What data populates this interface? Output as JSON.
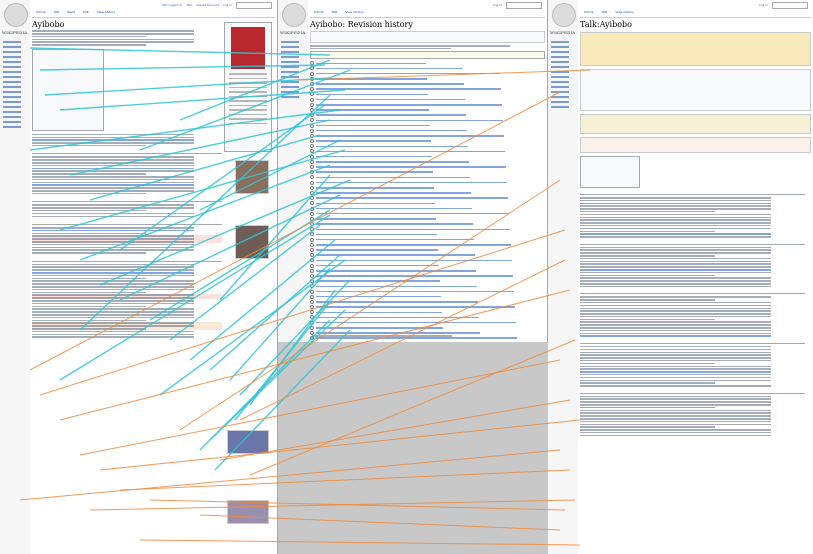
{
  "panels": [
    {
      "title": "Ayibobo",
      "wordmark": "WIKIPEDIA",
      "tabs": [
        "Article",
        "Talk",
        "Read",
        "Edit",
        "View history"
      ]
    },
    {
      "title": "Ayibobo: Revision history",
      "wordmark": "WIKIPEDIA",
      "tabs": [
        "Article",
        "Talk",
        "Read",
        "Edit",
        "View history"
      ]
    },
    {
      "title": "Talk:Ayibobo",
      "wordmark": "WIKIPEDIA",
      "tabs": [
        "Article",
        "Talk",
        "Read",
        "Edit",
        "View history"
      ]
    }
  ],
  "top_links": [
    "Not logged in",
    "Talk",
    "Contributions",
    "Create account",
    "Log in"
  ],
  "colors": {
    "link_line_teal": "#2ec4d6",
    "link_line_orange": "#f08a3c",
    "highlight_red": "#fde2dc"
  }
}
